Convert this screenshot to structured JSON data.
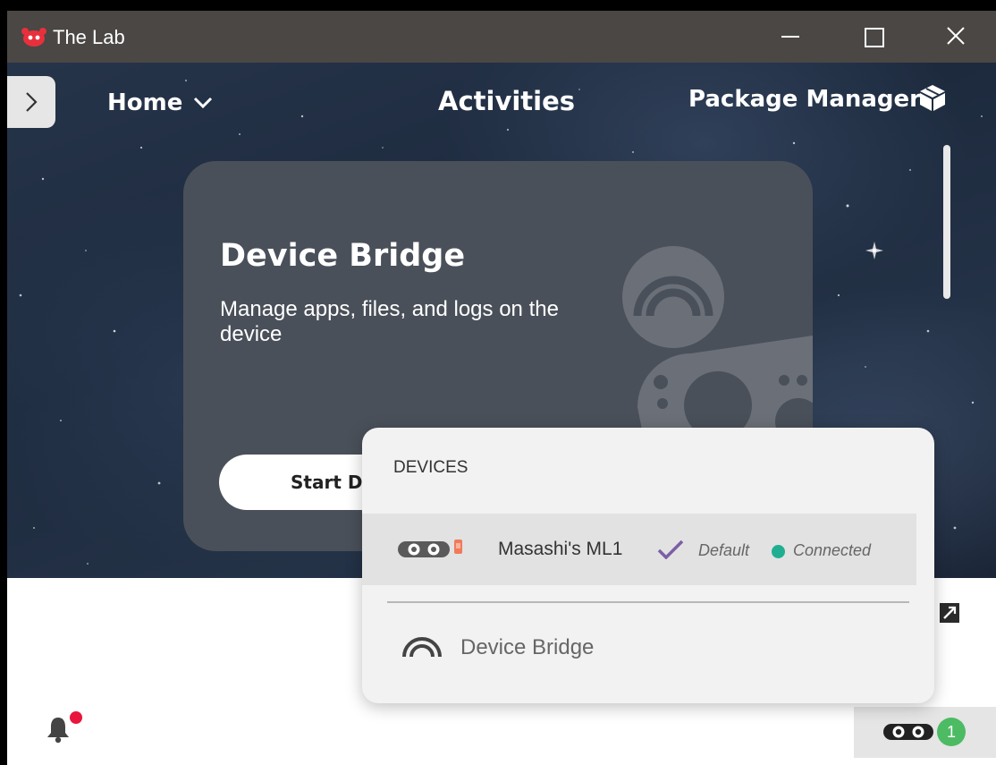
{
  "window": {
    "title": "The Lab"
  },
  "nav": {
    "home": "Home",
    "activities": "Activities",
    "package_manager": "Package Manager"
  },
  "card": {
    "title": "Device Bridge",
    "description": "Manage apps, files, and logs on the device",
    "start_button": "Start De"
  },
  "devices_popup": {
    "title": "DEVICES",
    "devices": [
      {
        "name": "Masashi's ML1",
        "default_label": "Default",
        "status": "Connected",
        "status_color": "#1fae91"
      }
    ],
    "footer_link": "Device Bridge"
  },
  "statusbar": {
    "device_count": "1",
    "notification_badge_color": "#e8163c",
    "count_badge_color": "#4cbb63"
  },
  "icons": [
    "app-logo-icon",
    "minimize-icon",
    "maximize-icon",
    "close-icon",
    "chevron-right-icon",
    "chevron-down-icon",
    "package-icon",
    "bell-icon",
    "goggles-icon",
    "check-icon",
    "device-bridge-icon",
    "expand-icon"
  ]
}
